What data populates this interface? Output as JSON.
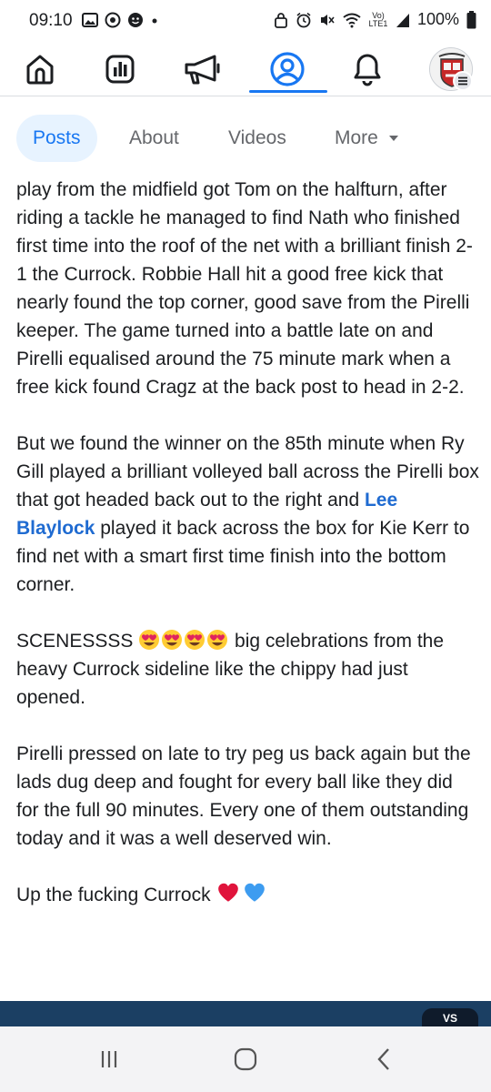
{
  "status_bar": {
    "time": "09:10",
    "network_label": "Vo) LTE1",
    "battery": "100%"
  },
  "tabs": [
    {
      "label": "Posts",
      "active": true
    },
    {
      "label": "About",
      "active": false
    },
    {
      "label": "Videos",
      "active": false
    },
    {
      "label": "More",
      "active": false
    }
  ],
  "post": {
    "para1": "play from the midfield got Tom on the halfturn, after riding a tackle he managed to find Nath who finished first time into the roof of the net with a brilliant finish 2-1 the Currock. Robbie Hall hit a good free kick that nearly found the top corner, good save from the Pirelli keeper. The game turned into a battle late on and Pirelli equalised around the 75 minute mark when a free kick found Cragz at the back post to head in 2-2.",
    "para2_before": "But we found the winner on the 85th minute when Ry Gill played a brilliant volleyed ball across the Pirelli box that got headed back out to the right and ",
    "mention": "Lee Blaylock",
    "para2_after": " played it back across the box for Kie Kerr to find net with a smart first time finish into the bottom corner.",
    "para3_before": "SCENESSSS ",
    "para3_after": " big celebrations from the heavy Currock sideline like the chippy had just opened.",
    "para4": "Pirelli pressed on late to try peg us back again but the lads dug deep and fought for every ball like they did for the full 90 minutes. Every one of them outstanding today and it was a well deserved win.",
    "para5": "Up the fucking Currock "
  },
  "strip": {
    "badge": "VS"
  },
  "colors": {
    "accent": "#1877f2",
    "mention": "#1f6bd1",
    "strip": "#1b3f63"
  }
}
